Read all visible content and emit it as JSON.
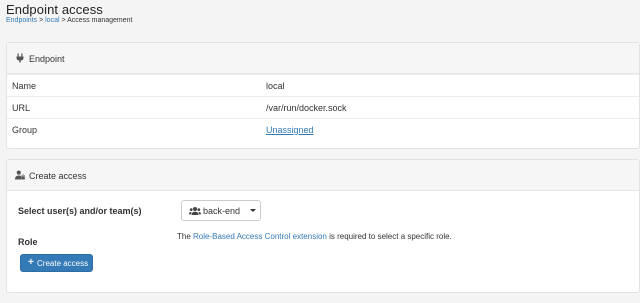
{
  "header": {
    "title": "Endpoint access",
    "breadcrumb": {
      "link1": "Endpoints",
      "sep1": " > ",
      "link2": "local",
      "sep2": " > ",
      "current": "Access management"
    }
  },
  "endpoint": {
    "title": "Endpoint",
    "icon": "plug-icon",
    "rows": [
      {
        "key": "Name",
        "value": "local"
      },
      {
        "key": "URL",
        "value": "/var/run/docker.sock"
      },
      {
        "key": "Group",
        "value": "Unassigned"
      }
    ]
  },
  "access": {
    "title": "Create access",
    "icon": "user-lock-icon",
    "select_label": "Select user(s) and/or team(s)",
    "select_value": "back-end",
    "role_label": "Role",
    "note": {
      "pre": "The ",
      "link": "Role-Based Access Control extension",
      "post": " is required to select a specific role."
    },
    "button_label": "Create access",
    "button_icon": "plus-icon"
  },
  "colors": {
    "link": "#337ab7",
    "primary": "#337ab7"
  }
}
